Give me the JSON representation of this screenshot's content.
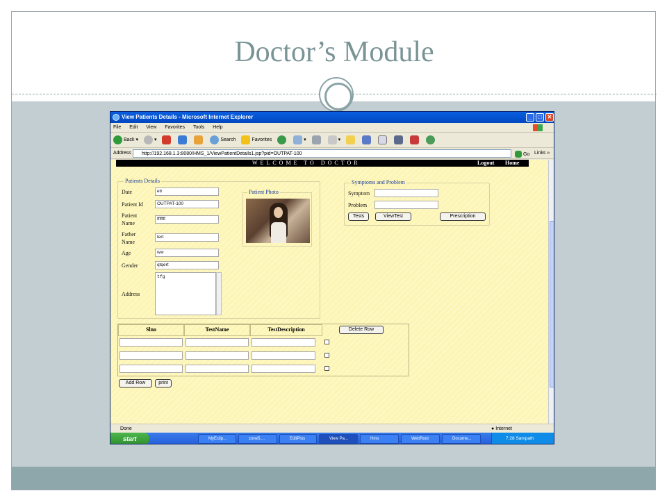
{
  "slide": {
    "title": "Doctor’s Module"
  },
  "browser": {
    "window_title": "View Patients Details - Microsoft Internet Explorer",
    "menu": [
      "File",
      "Edit",
      "View",
      "Favorites",
      "Tools",
      "Help"
    ],
    "toolbar": {
      "back": "Back",
      "search": "Search",
      "favorites": "Favorites"
    },
    "address": {
      "label": "Address",
      "url": "http://192.168.1.3:8080/HMS_1/ViewPatientDetails1.jsp?pid=OUTPAT-100",
      "go": "Go",
      "links": "Links"
    },
    "status": {
      "text": "Done",
      "zone": "Internet"
    }
  },
  "page": {
    "banner": "WELCOME TO DOCTOR",
    "logout": "Logout",
    "home": "Home",
    "patient": {
      "legend": "Patients Details",
      "date_label": "Date",
      "date_value": "etr",
      "id_label": "Patient Id",
      "id_value": "OUTPAT-100",
      "name_label_1": "Patient",
      "name_label_2": "Name",
      "name_value": "fffffff",
      "father_label_1": "Father",
      "father_label_2": "Name",
      "father_value": "tert",
      "age_label": "Age",
      "age_value": "ww",
      "gender_label": "Gender",
      "gender_value": "qtqert",
      "address_label": "Address",
      "address_value": "tfg"
    },
    "photo": {
      "legend": "Patient Photo"
    },
    "symptoms": {
      "legend": "Symptoms and Problem",
      "symptom_label": "Symptom",
      "symptom_value": "",
      "problem_label": "Problem",
      "problem_value": "",
      "tests_btn": "Tests",
      "viewtest_btn": "ViewTest",
      "prescription_btn": "Prescription"
    },
    "tests_table": {
      "headers": [
        "Slno",
        "TestName",
        "TestDescription"
      ],
      "delete_btn": "Delete Row",
      "add_btn": "Add Row",
      "print_btn": "print"
    }
  },
  "taskbar": {
    "start": "start",
    "tasks": [
      "MyEclip...",
      "zone5....",
      "EditPlus",
      "View Pa...",
      "Hms",
      "WebRoot",
      "Docume..."
    ],
    "time": "7:28 Sampath"
  }
}
